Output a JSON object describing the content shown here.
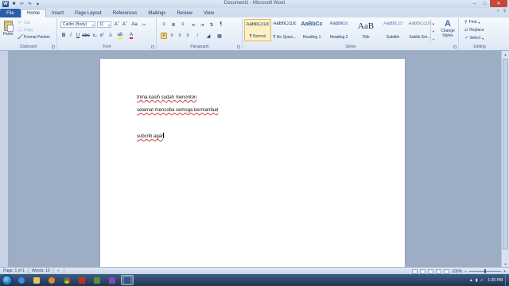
{
  "window": {
    "title": "Document1 - Microsoft Word"
  },
  "quick_access": {
    "save_icon": "save-icon",
    "undo_icon": "undo-icon",
    "redo_icon": "redo-icon"
  },
  "tabs": [
    {
      "label": "File"
    },
    {
      "label": "Home"
    },
    {
      "label": "Insert"
    },
    {
      "label": "Page Layout"
    },
    {
      "label": "References"
    },
    {
      "label": "Mailings"
    },
    {
      "label": "Review"
    },
    {
      "label": "View"
    }
  ],
  "clipboard": {
    "paste": "Paste",
    "cut": "Cut",
    "copy": "Copy",
    "format_painter": "Format Painter",
    "label": "Clipboard"
  },
  "font": {
    "name": "Calibri (Body)",
    "size": "11",
    "label": "Font"
  },
  "paragraph": {
    "label": "Paragraph"
  },
  "styles": {
    "label": "Styles",
    "items": [
      {
        "preview": "AaBbCcDc",
        "name": "¶ Normal"
      },
      {
        "preview": "AaBbCcDc",
        "name": "¶ No Spaci..."
      },
      {
        "preview": "AaBbCc",
        "name": "Heading 1"
      },
      {
        "preview": "AaBbCc",
        "name": "Heading 2"
      },
      {
        "preview": "AaB",
        "name": "Title"
      },
      {
        "preview": "AaBbCcI",
        "name": "Subtitle"
      },
      {
        "preview": "AaBbCcDc",
        "name": "Subtle Em..."
      }
    ],
    "change_styles": "Change Styles"
  },
  "editing": {
    "find": "Find",
    "replace": "Replace",
    "select": "Select",
    "label": "Editing"
  },
  "document": {
    "lines": [
      "trima kasih sudah menonton",
      "selamat mencoba semoga bermanfaat",
      "subcrib agar"
    ]
  },
  "status": {
    "page": "Page: 1 of 1",
    "words": "Words: 10",
    "zoom": "100%"
  },
  "taskbar": {
    "time": "1:25 PM"
  }
}
